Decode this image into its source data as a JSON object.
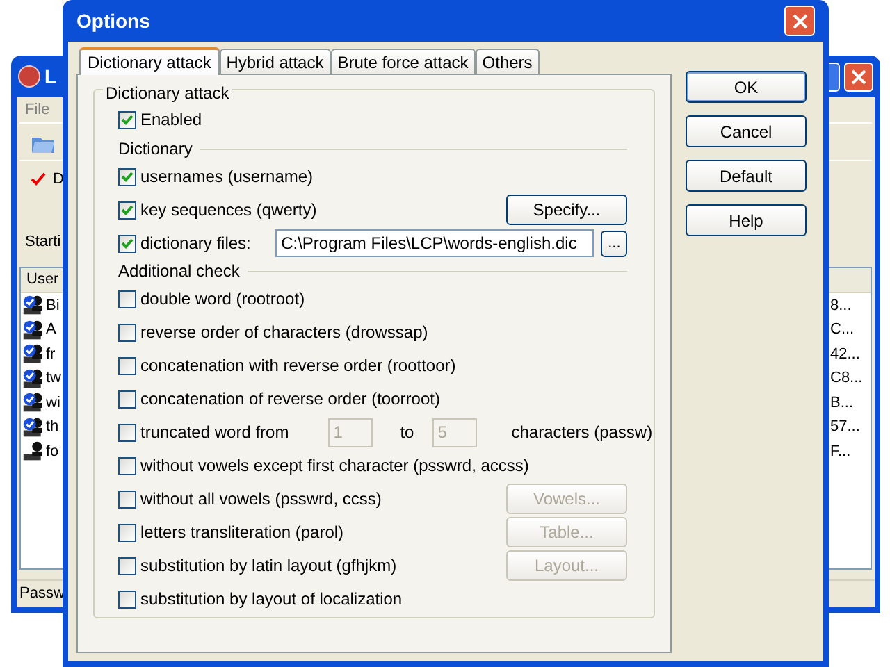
{
  "background_window": {
    "title": "L",
    "menu": [
      "File"
    ],
    "option": {
      "label": "D",
      "checked": true
    },
    "start_label": "Starti",
    "list": {
      "column": "User",
      "rows": [
        {
          "name": "Bi",
          "value": "8...",
          "verified": true
        },
        {
          "name": "A",
          "value": "C...",
          "verified": true
        },
        {
          "name": "fr",
          "value": "42...",
          "verified": true
        },
        {
          "name": "tw",
          "value": "C8...",
          "verified": true
        },
        {
          "name": "wi",
          "value": "B...",
          "verified": true
        },
        {
          "name": "th",
          "value": "57...",
          "verified": true
        },
        {
          "name": "fo",
          "value": "F...",
          "verified": false
        }
      ]
    },
    "status_bar": "Passw"
  },
  "dialog": {
    "title": "Options",
    "tabs": [
      {
        "label": "Dictionary attack",
        "selected": true
      },
      {
        "label": "Hybrid attack",
        "selected": false
      },
      {
        "label": "Brute force attack",
        "selected": false
      },
      {
        "label": "Others",
        "selected": false
      }
    ],
    "group": {
      "title": "Dictionary attack",
      "enabled": {
        "label": "Enabled",
        "checked": true
      },
      "dictionary": {
        "title": "Dictionary",
        "items": [
          {
            "kind": "check",
            "label": "usernames (username)",
            "checked": true
          },
          {
            "kind": "check",
            "label": "key sequences (qwerty)",
            "checked": true,
            "button": {
              "label": "Specify...",
              "disabled": false
            }
          },
          {
            "kind": "file",
            "label": "dictionary files:",
            "checked": true,
            "value": "C:\\Program Files\\LCP\\words-english.dic",
            "browse": "..."
          }
        ]
      },
      "additional": {
        "title": "Additional check",
        "items": [
          {
            "kind": "check",
            "label": "double word (rootroot)",
            "checked": false
          },
          {
            "kind": "check",
            "label": "reverse order of characters (drowssap)",
            "checked": false
          },
          {
            "kind": "check",
            "label": "concatenation with reverse order (roottoor)",
            "checked": false
          },
          {
            "kind": "check",
            "label": "concatenation of reverse order (toorroot)",
            "checked": false
          },
          {
            "kind": "range",
            "label": "truncated word from",
            "checked": false,
            "from": "1",
            "to_label": "to",
            "to": "5",
            "suffix": "characters (passw)"
          },
          {
            "kind": "check",
            "label": "without vowels except first character (psswrd, accss)",
            "checked": false
          },
          {
            "kind": "check",
            "label": "without all vowels (psswrd, ccss)",
            "checked": false,
            "button": {
              "label": "Vowels...",
              "disabled": true
            }
          },
          {
            "kind": "check",
            "label": "letters transliteration (parol)",
            "checked": false,
            "button": {
              "label": "Table...",
              "disabled": true
            }
          },
          {
            "kind": "check",
            "label": "substitution by latin layout (gfhjkm)",
            "checked": false,
            "button": {
              "label": "Layout...",
              "disabled": true
            }
          },
          {
            "kind": "check",
            "label": "substitution by layout of localization",
            "checked": false
          }
        ]
      }
    },
    "buttons": [
      {
        "label": "OK",
        "default": true
      },
      {
        "label": "Cancel",
        "default": false
      },
      {
        "label": "Default",
        "default": false
      },
      {
        "label": "Help",
        "default": false
      }
    ]
  }
}
